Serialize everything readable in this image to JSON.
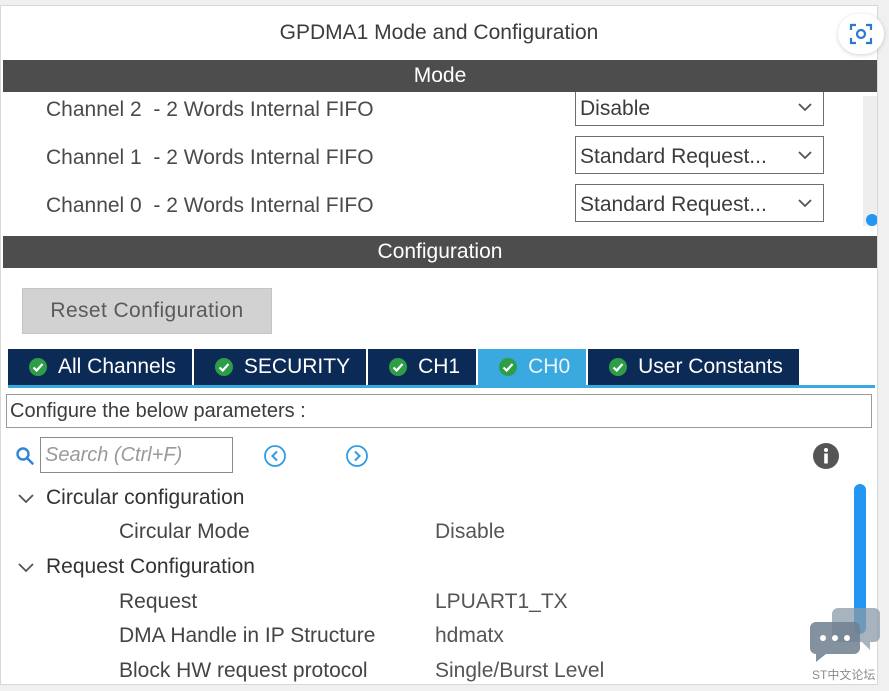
{
  "window": {
    "title": "GPDMA1 Mode and Configuration"
  },
  "mode": {
    "header": "Mode",
    "channels": [
      {
        "label": "Channel 2  - 2 Words Internal FIFO",
        "value": "Disable"
      },
      {
        "label": "Channel 1  - 2 Words Internal FIFO",
        "value": "Standard Request..."
      },
      {
        "label": "Channel 0  - 2 Words Internal FIFO",
        "value": "Standard Request..."
      }
    ]
  },
  "configuration": {
    "header": "Configuration",
    "reset_label": "Reset Configuration",
    "tabs": [
      {
        "label": "All Channels",
        "active": false
      },
      {
        "label": "SECURITY",
        "active": false
      },
      {
        "label": "CH1",
        "active": false
      },
      {
        "label": "CH0",
        "active": true
      },
      {
        "label": "User Constants",
        "active": false
      }
    ],
    "param_bar": "Configure the below parameters :",
    "search": {
      "placeholder": "Search (Ctrl+F)"
    },
    "groups": [
      {
        "label": "Circular configuration",
        "items": [
          {
            "key": "Circular Mode",
            "value": "Disable"
          }
        ]
      },
      {
        "label": "Request Configuration",
        "items": [
          {
            "key": "Request",
            "value": "LPUART1_TX"
          },
          {
            "key": "DMA Handle in IP Structure",
            "value": "hdmatx"
          },
          {
            "key": "Block HW request protocol",
            "value": "Single/Burst Level"
          }
        ]
      }
    ]
  },
  "overlay": {
    "watermark": "ST中文论坛"
  },
  "colors": {
    "header_bg": "#4d4d4d",
    "tab_bg": "#0b2a56",
    "tab_active_bg": "#3aa9e0",
    "scrollbar": "#2196f3",
    "check_green": "#2e9d48"
  },
  "icons": {
    "dropdown": "chevron-down-icon",
    "tab_status": "check-circle-icon",
    "search": "search-icon",
    "prev": "circle-chevron-left-icon",
    "next": "circle-chevron-right-icon",
    "info": "info-icon",
    "expand": "chevron-down-icon",
    "scan": "scan-icon",
    "chat": "chat-bubble-icon"
  }
}
